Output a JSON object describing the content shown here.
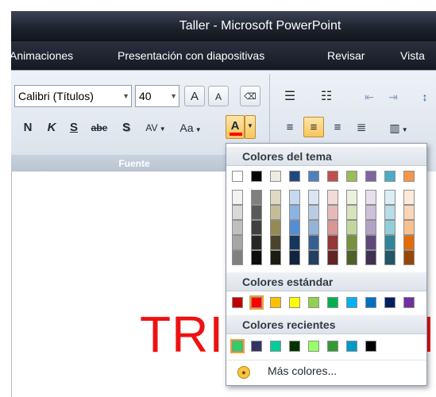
{
  "window": {
    "title": "Taller - Microsoft PowerPoint"
  },
  "ribbon_tabs": [
    "Animaciones",
    "Presentación con diapositivas",
    "Revisar",
    "Vista"
  ],
  "font_group": {
    "font_name": "Calibri (Títulos)",
    "font_size": "40",
    "group_label": "Fuente",
    "grow_label": "A",
    "shrink_label": "A",
    "bold_label": "N",
    "italic_label": "K",
    "underline_label": "S",
    "strike_label": "abe",
    "shadow_label": "S",
    "spacing_label": "AV",
    "case_label": "Aa",
    "font_color_label": "A",
    "font_color_value": "#ff0000"
  },
  "slide": {
    "text_left": "TRIG",
    "text_right": "I"
  },
  "color_popup": {
    "theme_header": "Colores del tema",
    "standard_header": "Colores estándar",
    "recent_header": "Colores recientes",
    "more_colors_label": "Más colores...",
    "theme_colors": [
      "#ffffff",
      "#000000",
      "#eeece1",
      "#1f497d",
      "#4f81bd",
      "#c0504d",
      "#9bbb59",
      "#8064a2",
      "#4bacc6",
      "#f79646"
    ],
    "theme_shades": [
      [
        "#f2f2f2",
        "#d9d9d9",
        "#bfbfbf",
        "#a6a6a6",
        "#808080"
      ],
      [
        "#7f7f7f",
        "#595959",
        "#404040",
        "#262626",
        "#0d0d0d"
      ],
      [
        "#ddd9c3",
        "#c4bd97",
        "#948a54",
        "#4a452a",
        "#1e1c11"
      ],
      [
        "#c6d9f0",
        "#8db3e2",
        "#548dd4",
        "#17365d",
        "#0f243e"
      ],
      [
        "#dbe5f1",
        "#b8cce4",
        "#95b3d7",
        "#366092",
        "#244061"
      ],
      [
        "#f2dcdb",
        "#e5b9b7",
        "#d99694",
        "#953734",
        "#632423"
      ],
      [
        "#ebf1dd",
        "#d7e3bc",
        "#c3d69b",
        "#76923c",
        "#4f6128"
      ],
      [
        "#e5e0ec",
        "#ccc1d9",
        "#b2a2c7",
        "#5f497a",
        "#3f3151"
      ],
      [
        "#dbeef3",
        "#b7dde8",
        "#92cddc",
        "#31859b",
        "#205867"
      ],
      [
        "#fdeada",
        "#fbd5b5",
        "#fac08f",
        "#e36c09",
        "#974806"
      ]
    ],
    "standard_colors": [
      "#c00000",
      "#ff0000",
      "#ffc000",
      "#ffff00",
      "#92d050",
      "#00b050",
      "#00b0f0",
      "#0070c0",
      "#002060",
      "#7030a0"
    ],
    "recent_colors": [
      "#33cc66",
      "#333366",
      "#00cc99",
      "#003300",
      "#99ff66",
      "#339933",
      "#0099cc",
      "#000000"
    ]
  },
  "colors": {
    "slide_text": "#ee1111",
    "popup_selection": "#e8a33c"
  }
}
